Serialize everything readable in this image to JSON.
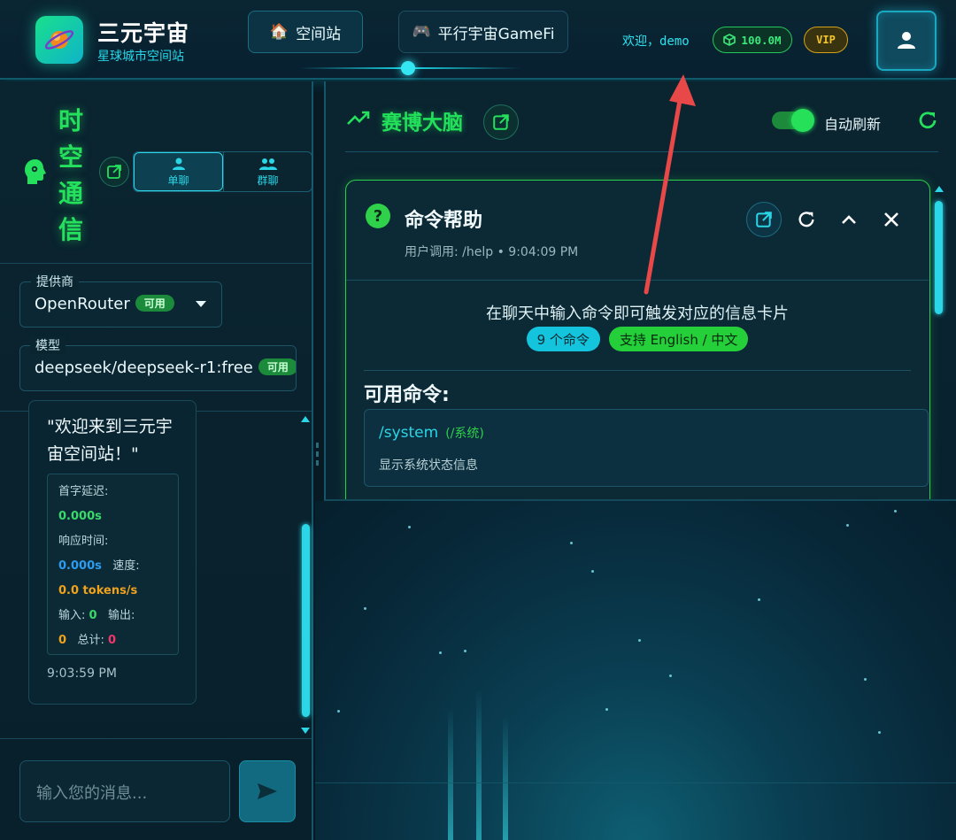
{
  "header": {
    "app_title": "三元宇宙",
    "app_subtitle": "星球城市空间站",
    "nav": [
      {
        "icon": "house-icon",
        "glyph": "🏠",
        "label": "空间站"
      },
      {
        "icon": "gamepad-icon",
        "glyph": "🎮",
        "label": "平行宇宙GameFi"
      }
    ],
    "welcome": "欢迎，demo",
    "credits": "100.0M",
    "vip": "VIP"
  },
  "left_panel": {
    "title_chars": [
      "时",
      "空",
      "通",
      "信"
    ],
    "tabs": [
      {
        "icon": "person-icon",
        "label": "单聊",
        "active": true
      },
      {
        "icon": "group-icon",
        "label": "群聊",
        "active": false
      }
    ],
    "provider": {
      "label": "提供商",
      "value": "OpenRouter",
      "badge": "可用"
    },
    "model": {
      "label": "模型",
      "value": "deepseek/deepseek-r1:free",
      "badge": "可用"
    },
    "message": {
      "text": "\"欢迎来到三元宇宙空间站！\"",
      "stats": {
        "first_token_label": "首字延迟:",
        "first_token_value": "0.000s",
        "response_label": "响应时间:",
        "response_value": "0.000s",
        "speed_label": "速度:",
        "speed_value": "0.0 tokens/s",
        "input_label": "输入:",
        "input_value": "0",
        "output_label": "输出:",
        "output_value": "0",
        "total_label": "总计:",
        "total_value": "0"
      },
      "time": "9:03:59 PM"
    },
    "input_placeholder": "输入您的消息..."
  },
  "right_panel": {
    "title": "赛博大脑",
    "auto_refresh_label": "自动刷新",
    "auto_refresh_on": true,
    "card": {
      "title": "命令帮助",
      "subtitle": "用户调用: /help • 9:04:09 PM",
      "description": "在聊天中输入命令即可触发对应的信息卡片",
      "pill_count": "9 个命令",
      "pill_lang": "支持 English / 中文",
      "available_label": "可用命令:",
      "commands": [
        {
          "name": "/system",
          "alias": "(/系统)",
          "info": "显示系统状态信息"
        }
      ]
    }
  },
  "colors": {
    "accent_cyan": "#2ad6e6",
    "accent_green": "#24e05c",
    "vip_gold": "#f3c52a",
    "background": "#071a24"
  }
}
